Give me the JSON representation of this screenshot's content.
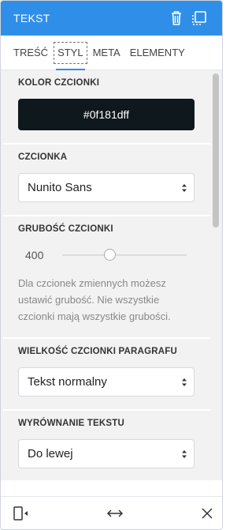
{
  "header": {
    "title": "TEKST",
    "trash_icon": "trash-icon",
    "duplicate_icon": "duplicate-icon",
    "background": "#2f8fe8"
  },
  "tabs": [
    {
      "label": "TREŚĆ",
      "active": false
    },
    {
      "label": "STYL",
      "active": true
    },
    {
      "label": "META",
      "active": false
    },
    {
      "label": "ELEMENTY",
      "active": false
    }
  ],
  "sections": {
    "font_color": {
      "label": "KOLOR CZCIONKI",
      "value": "#0f181dff",
      "swatch": "#0f181d"
    },
    "font": {
      "label": "CZCIONKA",
      "value": "Nunito Sans"
    },
    "font_weight": {
      "label": "GRUBOŚĆ CZCIONKI",
      "value": "400",
      "slider_position": 0.38,
      "help": "Dla czcionek zmiennych możesz ustawić grubość. Nie wszystkie czcionki mają wszystkie grubości."
    },
    "paragraph_size": {
      "label": "WIELKOŚĆ CZCIONKI PARAGRAFU",
      "value": "Tekst normalny"
    },
    "alignment": {
      "label": "WYRÓWNANIE TEKSTU",
      "value": "Do lewej"
    }
  },
  "footer": {
    "left_icon": "device-preview-icon",
    "middle_icon": "resize-horizontal-icon",
    "right_icon": "close-icon"
  }
}
